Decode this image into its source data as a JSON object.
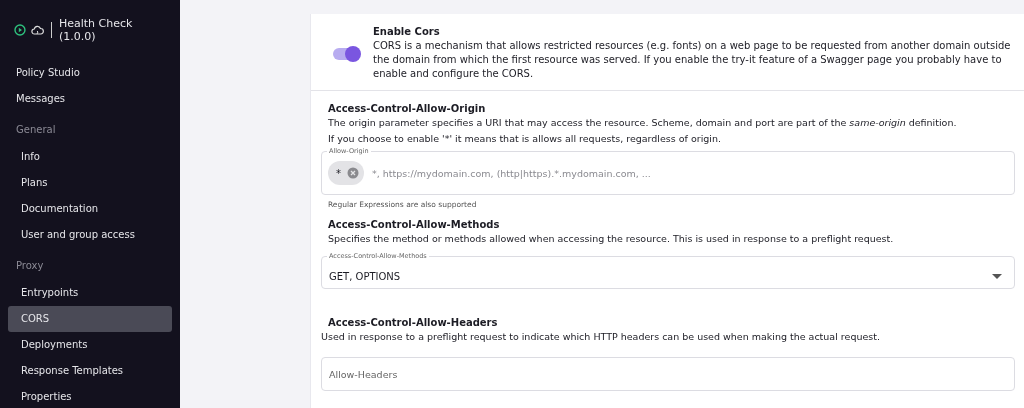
{
  "sidebar": {
    "header": {
      "title": "Health Check (1.0.0)"
    },
    "items": [
      {
        "label": "Policy Studio",
        "selected": false
      },
      {
        "label": "Messages",
        "selected": false
      }
    ],
    "sections": [
      {
        "title": "General",
        "items": [
          {
            "label": "Info",
            "selected": false
          },
          {
            "label": "Plans",
            "selected": false
          },
          {
            "label": "Documentation",
            "selected": false
          },
          {
            "label": "User and group access",
            "selected": false
          }
        ]
      },
      {
        "title": "Proxy",
        "items": [
          {
            "label": "Entrypoints",
            "selected": false
          },
          {
            "label": "CORS",
            "selected": true
          },
          {
            "label": "Deployments",
            "selected": false
          },
          {
            "label": "Response Templates",
            "selected": false
          },
          {
            "label": "Properties",
            "selected": false
          }
        ]
      }
    ]
  },
  "enable": {
    "title": "Enable Cors",
    "on": true,
    "description": "CORS is a mechanism that allows restricted resources (e.g. fonts) on a web page to be requested from another domain outside the domain from which the first resource was served. If you enable the try-it feature of a Swagger page you probably have to enable and configure the CORS."
  },
  "origin": {
    "title": "Access-Control-Allow-Origin",
    "description": "The origin parameter specifies a URI that may access the resource. Scheme, domain and port are part of the *same-origin* definition.",
    "description_2": "If you choose to enable '*' it means that is allows all requests, regardless of origin.",
    "field_label": "Allow-Origin",
    "chips": [
      "*"
    ],
    "placeholder": "*, https://mydomain.com, (http|https).*.mydomain.com, ...",
    "hint": "Regular Expressions are also supported"
  },
  "methods": {
    "title": "Access-Control-Allow-Methods",
    "description": "Specifies the method or methods allowed when accessing the resource. This is used in response to a preflight request.",
    "field_label": "Access-Control-Allow-Methods",
    "value": "GET, OPTIONS"
  },
  "headers": {
    "title": "Access-Control-Allow-Headers",
    "description": "Used in response to a preflight request to indicate which HTTP headers can be used when making the actual request.",
    "placeholder": "Allow-Headers"
  }
}
